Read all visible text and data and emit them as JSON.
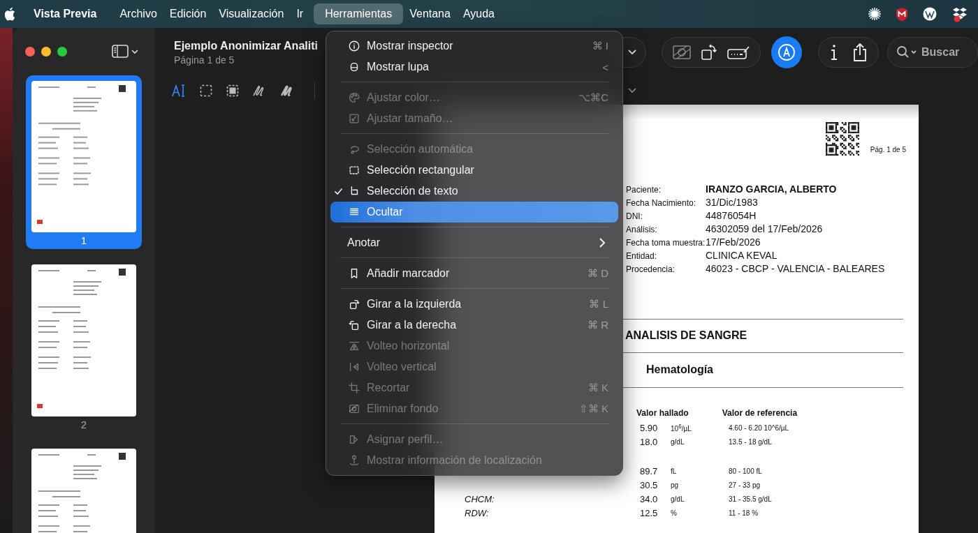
{
  "menubar": {
    "app": "Vista Previa",
    "menus": [
      {
        "label": "Archivo",
        "selected": false
      },
      {
        "label": "Edición",
        "selected": false
      },
      {
        "label": "Visualización",
        "selected": false
      },
      {
        "label": "Ir",
        "selected": false
      },
      {
        "label": "Herramientas",
        "selected": true
      },
      {
        "label": "Ventana",
        "selected": false
      },
      {
        "label": "Ayuda",
        "selected": false
      }
    ]
  },
  "window": {
    "title": "Ejemplo Anonimizar Analiti",
    "subtitle": "Página 1 de 5",
    "search_placeholder": "Buscar"
  },
  "sidebar": {
    "pages": [
      {
        "label": "1",
        "selected": true
      },
      {
        "label": "2",
        "selected": false
      },
      {
        "selected": false
      }
    ]
  },
  "menu": {
    "items": [
      {
        "kind": "item",
        "label": "Mostrar inspector",
        "shortcut": "⌘ I",
        "disabled": false,
        "checked": false,
        "selected": false
      },
      {
        "kind": "item",
        "label": "Mostrar lupa",
        "shortcut": "<",
        "disabled": false,
        "checked": false,
        "selected": false
      },
      {
        "kind": "separator"
      },
      {
        "kind": "item",
        "label": "Ajustar color…",
        "shortcut": "⌥⌘C",
        "disabled": true,
        "checked": false,
        "selected": false
      },
      {
        "kind": "item",
        "label": "Ajustar tamaño…",
        "disabled": true,
        "checked": false,
        "selected": false
      },
      {
        "kind": "separator"
      },
      {
        "kind": "item",
        "label": "Selección automática",
        "disabled": true,
        "checked": false,
        "selected": false
      },
      {
        "kind": "item",
        "label": "Selección rectangular",
        "disabled": false,
        "checked": false,
        "selected": false
      },
      {
        "kind": "item",
        "label": "Selección de texto",
        "disabled": false,
        "checked": true,
        "selected": false
      },
      {
        "kind": "item",
        "label": "Ocultar",
        "disabled": false,
        "checked": false,
        "selected": true
      },
      {
        "kind": "separator"
      },
      {
        "kind": "submenu",
        "label": "Anotar",
        "disabled": false,
        "selected": false
      },
      {
        "kind": "separator"
      },
      {
        "kind": "item",
        "label": "Añadir marcador",
        "shortcut": "⌘ D",
        "disabled": false,
        "checked": false,
        "selected": false
      },
      {
        "kind": "separator"
      },
      {
        "kind": "item",
        "label": "Girar a la izquierda",
        "shortcut": "⌘ L",
        "disabled": false,
        "checked": false,
        "selected": false
      },
      {
        "kind": "item",
        "label": "Girar a la derecha",
        "shortcut": "⌘ R",
        "disabled": false,
        "checked": false,
        "selected": false
      },
      {
        "kind": "item",
        "label": "Volteo horizontal",
        "disabled": true,
        "checked": false,
        "selected": false
      },
      {
        "kind": "item",
        "label": "Volteo vertical",
        "disabled": true,
        "checked": false,
        "selected": false
      },
      {
        "kind": "item",
        "label": "Recortar",
        "shortcut": "⌘ K",
        "disabled": true,
        "checked": false,
        "selected": false
      },
      {
        "kind": "item",
        "label": "Eliminar fondo",
        "shortcut": "⇧⌘ K",
        "disabled": true,
        "checked": false,
        "selected": false
      },
      {
        "kind": "separator"
      },
      {
        "kind": "item",
        "label": "Asignar perfil…",
        "disabled": true,
        "checked": false,
        "selected": false
      },
      {
        "kind": "item",
        "label": "Mostrar información de localización",
        "disabled": true,
        "checked": false,
        "selected": false
      }
    ]
  },
  "document": {
    "page_label": "Pág. 1 de 5",
    "patient": [
      {
        "label": "Paciente:",
        "value": "IRANZO GARCIA, ALBERTO"
      },
      {
        "label": "Fecha Nacimiento:",
        "value": "31/Dic/1983"
      },
      {
        "label": "DNI:",
        "value": "44876054H"
      },
      {
        "label": "Análisis:",
        "value": "46302059 del 17/Feb/2026"
      },
      {
        "label": "Fecha toma muestra:",
        "value": "17/Feb/2026"
      },
      {
        "label": "Entidad:",
        "value": "CLINICA KEVAL"
      },
      {
        "label": "Procedencia:",
        "value": "46023 - CBCP - VALENCIA - BALEARES"
      }
    ],
    "title": "ANALISIS DE SANGRE",
    "section": "Hematología",
    "columns": [
      "Valor hallado",
      "Valor de referencia"
    ],
    "groups": [
      [
        {
          "value": "5.90",
          "unit": "10$^{6}$/µL",
          "reference": "4.60 - 6.20 10^6/µL"
        },
        {
          "value": "18.0",
          "unit": "g/dL",
          "reference": "13.5 - 18 g/dL"
        }
      ],
      [
        {
          "value": "89.7",
          "unit": "fL",
          "reference": "80 - 100 fL"
        },
        {
          "value": "30.5",
          "unit": "pg",
          "reference": "27 - 33 pg"
        },
        {
          "label": "CHCM:",
          "value": "34.0",
          "unit": "g/dL",
          "reference": "31 - 35.5 g/dL"
        },
        {
          "label": "RDW:",
          "value": "12.5",
          "unit": "%",
          "reference": "11 - 18 %"
        }
      ]
    ]
  }
}
